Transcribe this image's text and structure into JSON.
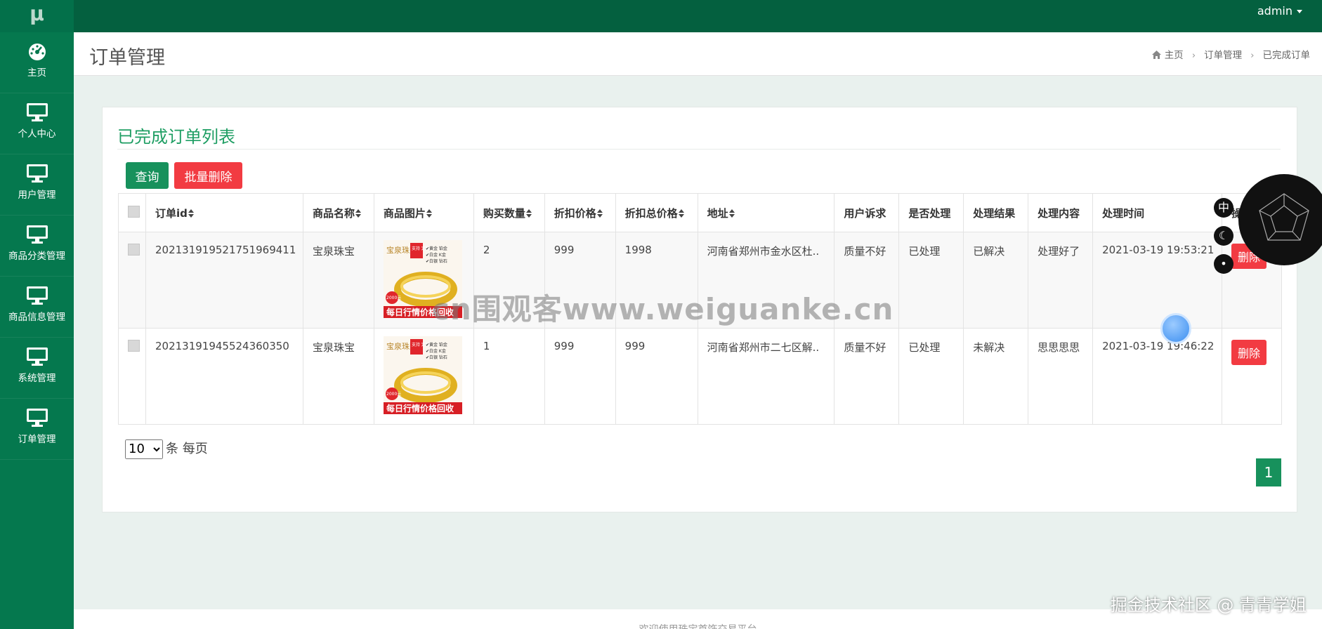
{
  "app": {
    "logo": "μ",
    "user": "admin"
  },
  "sidebar": {
    "items": [
      {
        "label": "主页",
        "icon": "dashboard-icon"
      },
      {
        "label": "个人中心",
        "icon": "monitor-icon"
      },
      {
        "label": "用户管理",
        "icon": "monitor-icon"
      },
      {
        "label": "商品分类管理",
        "icon": "monitor-icon"
      },
      {
        "label": "商品信息管理",
        "icon": "monitor-icon"
      },
      {
        "label": "系统管理",
        "icon": "monitor-icon"
      },
      {
        "label": "订单管理",
        "icon": "monitor-icon"
      }
    ]
  },
  "header": {
    "title": "订单管理",
    "breadcrumb": [
      "主页",
      "订单管理",
      "已完成订单"
    ]
  },
  "card": {
    "title": "已完成订单列表",
    "query_label": "查询",
    "batch_delete_label": "批量删除"
  },
  "table": {
    "columns": [
      "订单id",
      "商品名称",
      "商品图片",
      "购买数量",
      "折扣价格",
      "折扣总价格",
      "地址",
      "用户诉求",
      "是否处理",
      "处理结果",
      "处理内容",
      "处理时间",
      "操作"
    ],
    "sortable": [
      true,
      true,
      true,
      true,
      true,
      true,
      true,
      false,
      false,
      false,
      false,
      false,
      false
    ],
    "rows": [
      {
        "id": "20213191952175196941​1",
        "name": "宝泉珠宝",
        "qty": "2",
        "price": "999",
        "total": "1998",
        "address": "河南省郑州市金水区杜..",
        "appeal": "质量不好",
        "handled": "已处理",
        "result": "已解决",
        "content": "处理好了",
        "time": "2021-03-19 19:53:21",
        "delete": "删除"
      },
      {
        "id": "20213191945524360350",
        "name": "宝泉珠宝",
        "qty": "1",
        "price": "999",
        "total": "999",
        "address": "河南省郑州市二七区解..",
        "appeal": "质量不好",
        "handled": "已处理",
        "result": "未解决",
        "content": "思思思思",
        "time": "2021-03-19 19:46:22",
        "delete": "删除"
      }
    ],
    "image_text": {
      "badge": "支持 定制",
      "brand": "宝泉珠宝",
      "list": [
        "✔黄金 铂金",
        "✔白金 K金",
        "✔白银 钻石"
      ],
      "banner": "每日行情价格回收",
      "year": "2000元"
    }
  },
  "pagination": {
    "page_size": "10",
    "page_size_suffix": "条 每页",
    "current_page": "1"
  },
  "footer": {
    "text": "欢迎使用珠宝首饰交易平台"
  },
  "overlays": {
    "watermark": "cn围观客www.weiguanke.cn",
    "lang_badge": "中",
    "corner_tag": "掘金技术社区 @ 青青学姐"
  },
  "colors": {
    "sidebar": "#05784e",
    "topbar": "#04603f",
    "primary": "#17915c",
    "danger": "#f23b42",
    "title_green": "#1e9e63"
  }
}
